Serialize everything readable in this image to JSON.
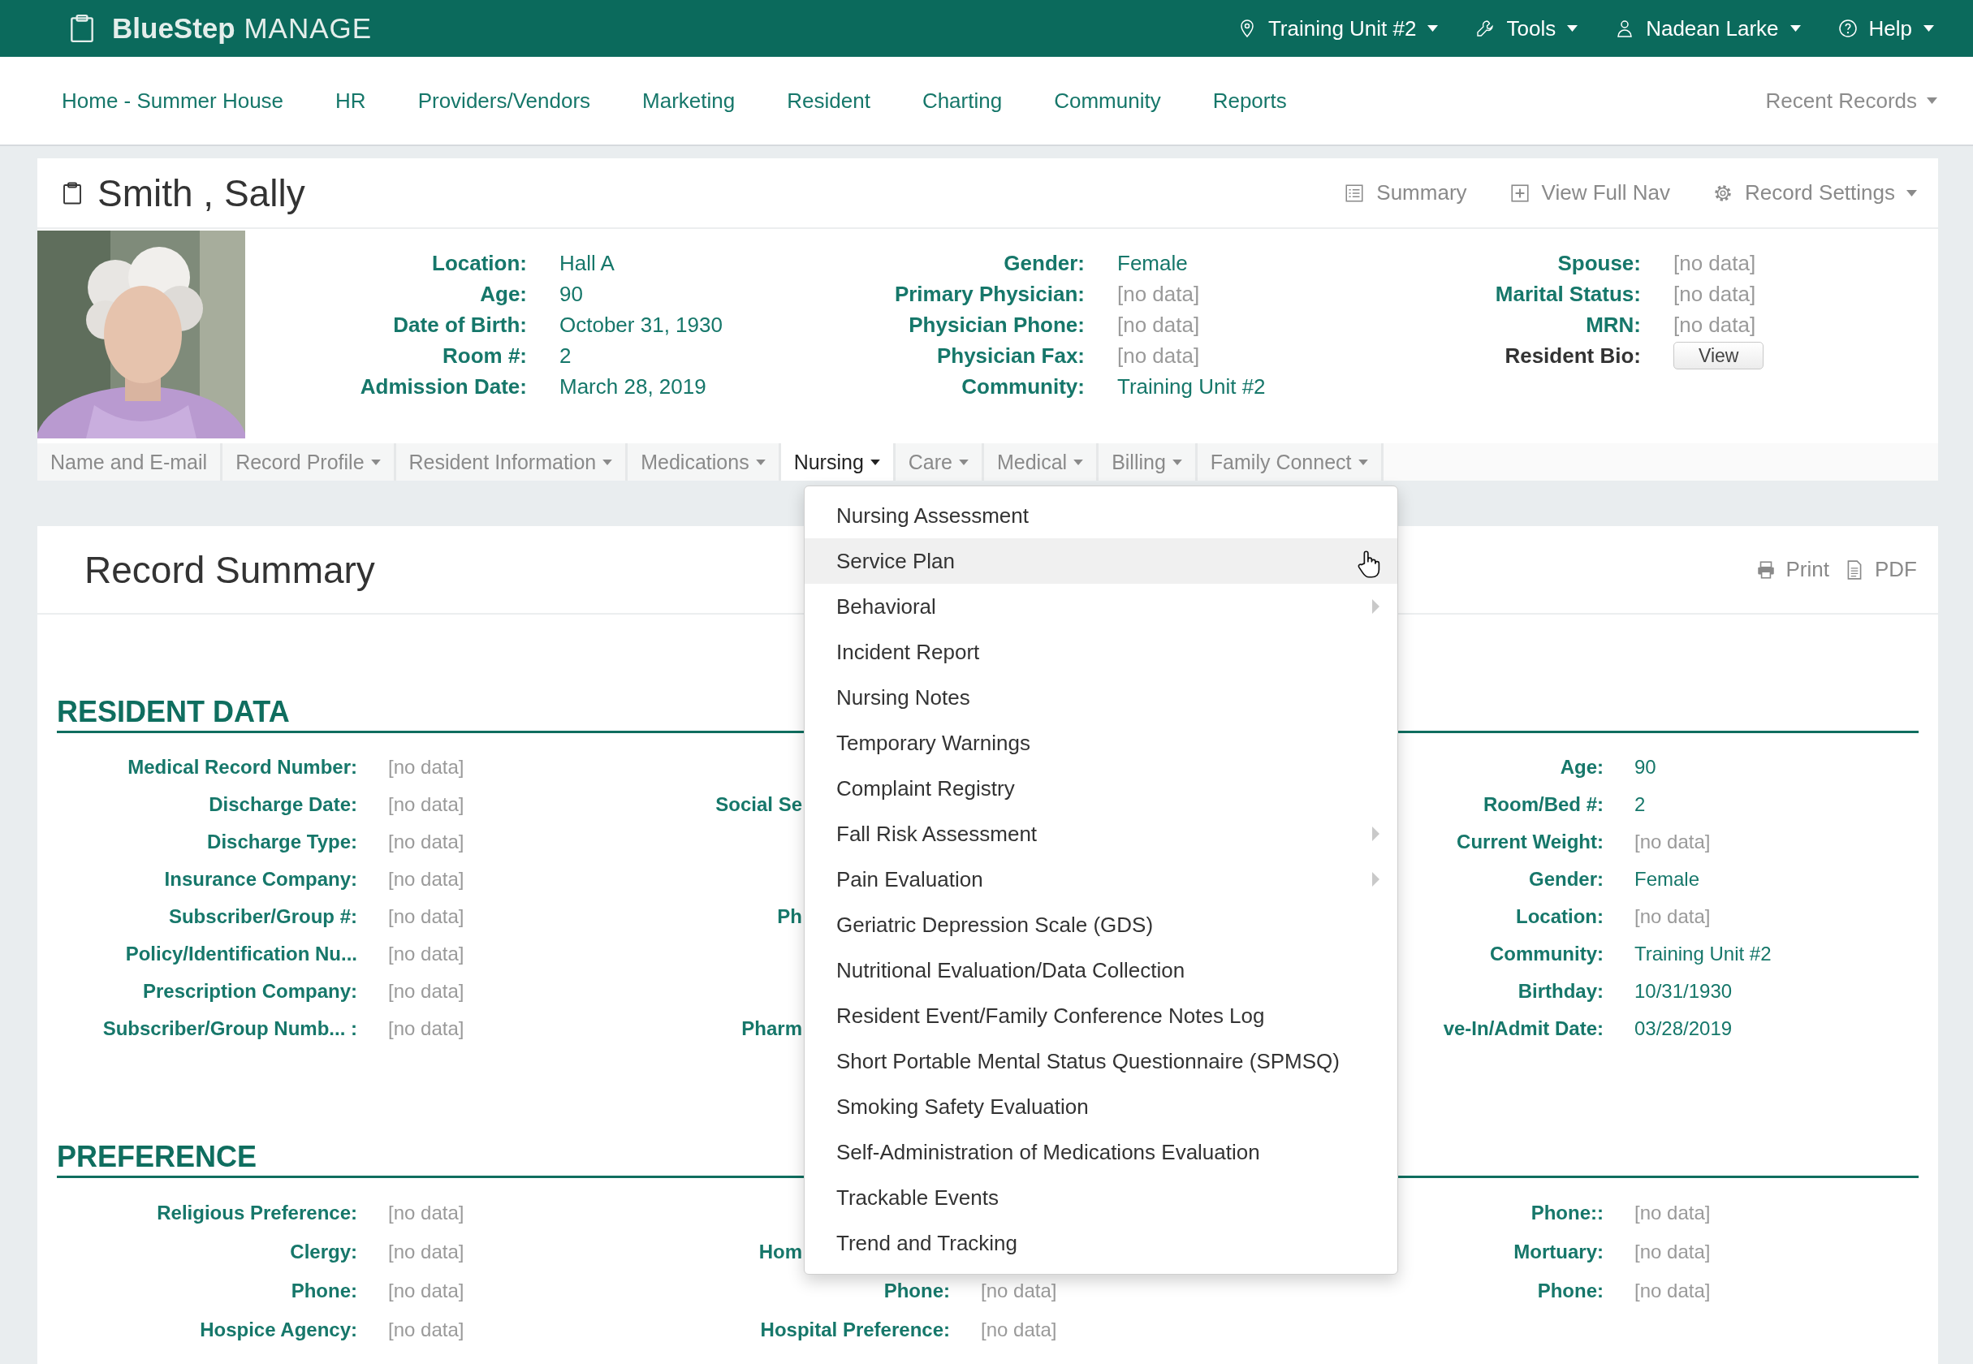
{
  "top_bar": {
    "brand": "**BlueStep** MANAGE",
    "menus": [
      {
        "label": "Training Unit #2",
        "kind": "location"
      },
      {
        "label": "Tools",
        "kind": "tools"
      },
      {
        "label": "Nadean Larke",
        "kind": "user"
      },
      {
        "label": "Help",
        "kind": "help"
      }
    ]
  },
  "main_nav": {
    "items": [
      "Home - Summer House",
      "HR",
      "Providers/Vendors",
      "Marketing",
      "Resident",
      "Charting",
      "Community",
      "Reports"
    ],
    "recent_records": "Recent Records"
  },
  "record": {
    "name": "Smith , Sally",
    "actions": [
      {
        "label": "Summary",
        "kind": "summary"
      },
      {
        "label": "View Full Nav",
        "kind": "nav"
      },
      {
        "label": "Record Settings",
        "kind": "settings"
      }
    ],
    "info_columns": [
      [
        {
          "label": "Location:",
          "value": "Hall A",
          "kind": "value"
        },
        {
          "label": "Age:",
          "value": "90",
          "kind": "value"
        },
        {
          "label": "Date of Birth:",
          "value": "October 31, 1930",
          "kind": "value"
        },
        {
          "label": "Room #:",
          "value": "2",
          "kind": "value"
        },
        {
          "label": "Admission Date:",
          "value": "March 28, 2019",
          "kind": "value"
        }
      ],
      [
        {
          "label": "Gender:",
          "value": "Female",
          "kind": "value"
        },
        {
          "label": "Primary Physician:",
          "value": "[no data]",
          "kind": "no_data"
        },
        {
          "label": "Physician Phone:",
          "value": "[no data]",
          "kind": "no_data"
        },
        {
          "label": "Physician Fax:",
          "value": "[no data]",
          "kind": "no_data"
        },
        {
          "label": "Community:",
          "value": "Training Unit #2",
          "kind": "value"
        }
      ],
      [
        {
          "label": "Spouse:",
          "value": "[no data]",
          "kind": "no_data"
        },
        {
          "label": "Marital Status:",
          "value": "[no data]",
          "kind": "no_data"
        },
        {
          "label": "MRN:",
          "value": "[no data]",
          "kind": "no_data"
        },
        {
          "label": "Resident Bio:",
          "value": "View",
          "kind": "button"
        }
      ]
    ],
    "tabs": [
      {
        "label": "Name and E-mail",
        "selected": false,
        "has_menu": false
      },
      {
        "label": "Record Profile",
        "selected": false,
        "has_menu": true
      },
      {
        "label": "Resident Information",
        "selected": false,
        "has_menu": true
      },
      {
        "label": "Medications",
        "selected": false,
        "has_menu": true
      },
      {
        "label": "Nursing",
        "selected": true,
        "has_menu": true
      },
      {
        "label": "Care",
        "selected": false,
        "has_menu": true
      },
      {
        "label": "Medical",
        "selected": false,
        "has_menu": true
      },
      {
        "label": "Billing",
        "selected": false,
        "has_menu": true
      },
      {
        "label": "Family Connect",
        "selected": false,
        "has_menu": true
      }
    ]
  },
  "summary": {
    "title": "Record Summary",
    "actions": [
      {
        "label": "Print",
        "kind": "print"
      },
      {
        "label": "PDF",
        "kind": "pdf"
      }
    ],
    "sections": [
      {
        "heading": "RESIDENT DATA",
        "columns": [
          [
            {
              "label": "Medical Record Number:",
              "value": "[no data]",
              "kind": "no_data"
            },
            {
              "label": "Discharge Date:",
              "value": "[no data]",
              "kind": "no_data"
            },
            {
              "label": "Discharge Type:",
              "value": "[no data]",
              "kind": "no_data"
            },
            {
              "label": "Insurance Company:",
              "value": "[no data]",
              "kind": "no_data"
            },
            {
              "label": "Subscriber/Group #:",
              "value": "[no data]",
              "kind": "no_data"
            },
            {
              "label": "Policy/Identification Nu...",
              "value": "[no data]",
              "kind": "no_data"
            },
            {
              "label": "Prescription Company:",
              "value": "[no data]",
              "kind": "no_data"
            },
            {
              "label": "Subscriber/Group Numb... :",
              "value": "[no data]",
              "kind": "no_data"
            }
          ],
          [
            {
              "label": "Social Se",
              "kind": "covered"
            },
            {
              "label": "Ph",
              "kind": "covered"
            },
            {
              "label": "Pharm",
              "kind": "covered"
            }
          ],
          [
            {
              "label": "Age:",
              "value": "90",
              "kind": "value"
            },
            {
              "label": "Room/Bed #:",
              "value": "2",
              "kind": "value"
            },
            {
              "label": "Current Weight:",
              "value": "[no data]",
              "kind": "no_data"
            },
            {
              "label": "Gender:",
              "value": "Female",
              "kind": "value"
            },
            {
              "label": "Location:",
              "value": "[no data]",
              "kind": "no_data"
            },
            {
              "label": "Community:",
              "value": "Training Unit #2",
              "kind": "value"
            },
            {
              "label": "Birthday:",
              "value": "10/31/1930",
              "kind": "value"
            },
            {
              "label": "ve-In/Admit Date:",
              "value": "03/28/2019",
              "kind": "value"
            }
          ]
        ]
      },
      {
        "heading": "PREFERENCE",
        "columns": [
          [
            {
              "label": "Religious Preference:",
              "value": "[no data]",
              "kind": "no_data"
            },
            {
              "label": "Clergy:",
              "value": "[no data]",
              "kind": "no_data"
            },
            {
              "label": "Phone:",
              "value": "[no data]",
              "kind": "no_data"
            },
            {
              "label": "Hospice Agency:",
              "value": "[no data]",
              "kind": "no_data"
            }
          ],
          [
            {
              "label": "Hom",
              "kind": "covered"
            },
            {
              "label": "Phone:",
              "value": "[no data]",
              "kind": "no_data"
            },
            {
              "label": "Hospital Preference:",
              "value": "[no data]",
              "kind": "no_data"
            }
          ],
          [
            {
              "label": "Phone::",
              "value": "[no data]",
              "kind": "no_data"
            },
            {
              "label": "Mortuary:",
              "value": "[no data]",
              "kind": "no_data"
            },
            {
              "label": "Phone:",
              "value": "[no data]",
              "kind": "no_data"
            }
          ]
        ]
      }
    ]
  },
  "nursing_menu": {
    "items": [
      {
        "label": "Nursing Assessment",
        "highlighted": false,
        "has_submenu": false
      },
      {
        "label": "Service Plan",
        "highlighted": true,
        "has_submenu": false
      },
      {
        "label": "Behavioral",
        "highlighted": false,
        "has_submenu": true
      },
      {
        "label": "Incident Report",
        "highlighted": false,
        "has_submenu": false
      },
      {
        "label": "Nursing Notes",
        "highlighted": false,
        "has_submenu": false
      },
      {
        "label": "Temporary Warnings",
        "highlighted": false,
        "has_submenu": false
      },
      {
        "label": "Complaint Registry",
        "highlighted": false,
        "has_submenu": false
      },
      {
        "label": "Fall Risk Assessment",
        "highlighted": false,
        "has_submenu": true
      },
      {
        "label": "Pain Evaluation",
        "highlighted": false,
        "has_submenu": true
      },
      {
        "label": "Geriatric Depression Scale (GDS)",
        "highlighted": false,
        "has_submenu": false
      },
      {
        "label": "Nutritional Evaluation/Data Collection",
        "highlighted": false,
        "has_submenu": false
      },
      {
        "label": "Resident Event/Family Conference Notes Log",
        "highlighted": false,
        "has_submenu": false
      },
      {
        "label": "Short Portable Mental Status Questionnaire (SPMSQ)",
        "highlighted": false,
        "has_submenu": false
      },
      {
        "label": "Smoking Safety Evaluation",
        "highlighted": false,
        "has_submenu": false
      },
      {
        "label": "Self-Administration of Medications Evaluation",
        "highlighted": false,
        "has_submenu": false
      },
      {
        "label": "Trackable Events",
        "highlighted": false,
        "has_submenu": false
      },
      {
        "label": "Trend and Tracking",
        "highlighted": false,
        "has_submenu": false
      }
    ]
  }
}
